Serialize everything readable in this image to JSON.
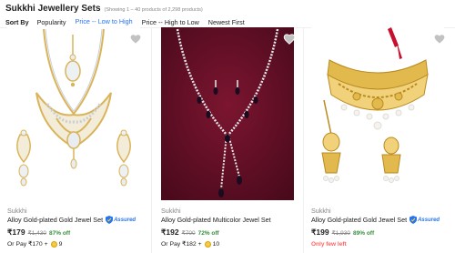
{
  "header": {
    "title": "Sukkhi Jewellery Sets",
    "count": "(Showing 1 – 40 products of 2,298 products)"
  },
  "sort": {
    "label": "Sort By",
    "options": [
      "Popularity",
      "Price -- Low to High",
      "Price -- High to Low",
      "Newest First"
    ],
    "active": "Price -- Low to High"
  },
  "colors": {
    "accent": "#2874f0",
    "discount": "#388e3c",
    "stock_warning": "#ff6161",
    "muted": "#878787"
  },
  "products": [
    {
      "brand": "Sukkhi",
      "name": "Alloy Gold-plated Gold Jewel Set",
      "assured": "Assured",
      "price": "₹179",
      "mrp": "₹1,430",
      "off": "87% off",
      "orpay": "Or Pay ₹170 +",
      "coins": "9"
    },
    {
      "brand": "Sukkhi",
      "name": "Alloy Gold-plated Multicolor Jewel Set",
      "price": "₹192",
      "mrp": "₹700",
      "off": "72% off",
      "orpay": "Or Pay ₹182 +",
      "coins": "10"
    },
    {
      "brand": "Sukkhi",
      "name": "Alloy Gold-plated Gold Jewel Set",
      "assured": "Assured",
      "price": "₹199",
      "mrp": "₹1,930",
      "off": "89% off",
      "stock_note": "Only few left"
    }
  ]
}
